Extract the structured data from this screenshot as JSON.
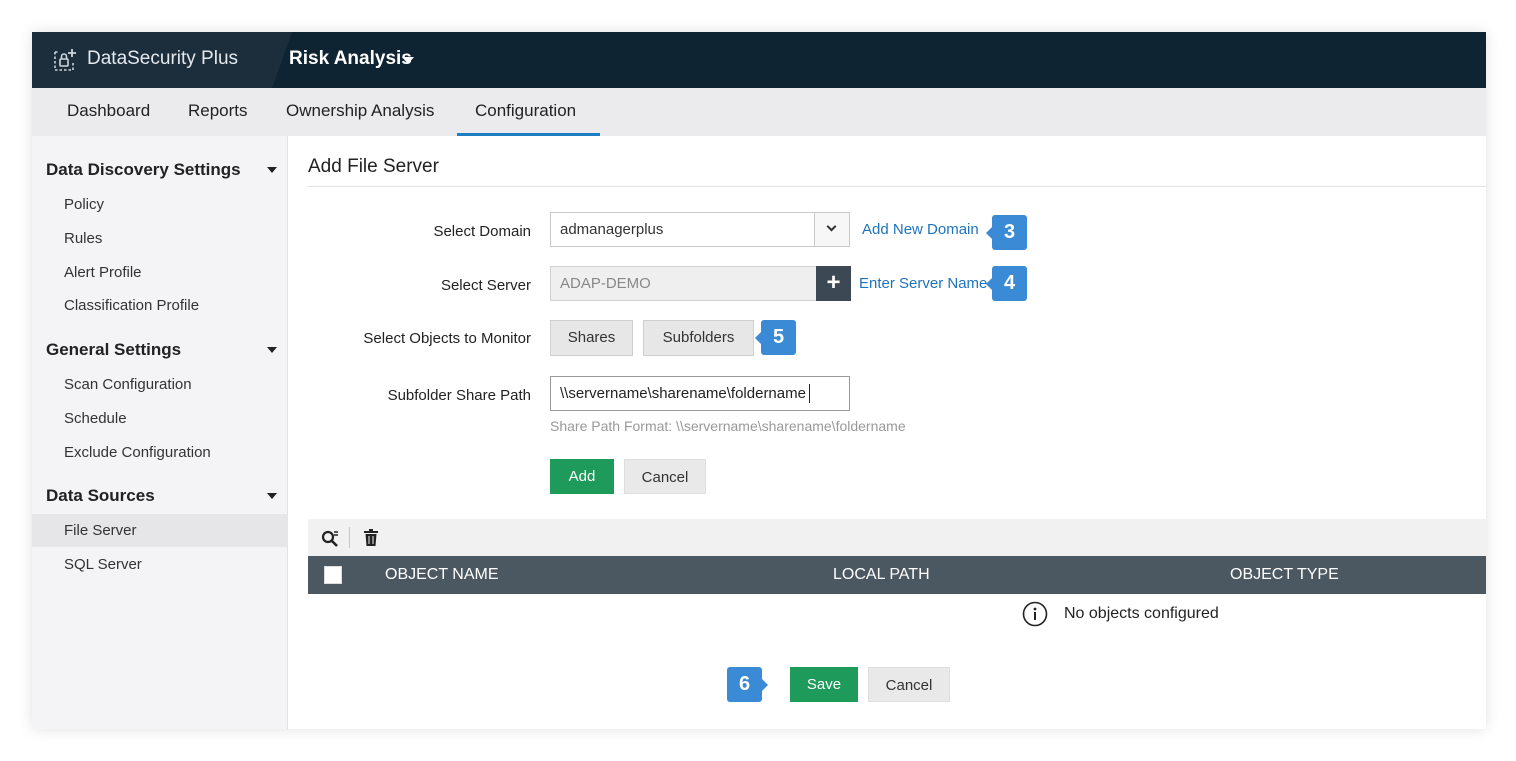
{
  "app": {
    "brand": "DataSecurity Plus",
    "module": "Risk Analysis"
  },
  "tabs": [
    {
      "label": "Dashboard"
    },
    {
      "label": "Reports"
    },
    {
      "label": "Ownership Analysis"
    },
    {
      "label": "Configuration",
      "active": true
    }
  ],
  "sidebar": {
    "sections": [
      {
        "title": "Data Discovery Settings",
        "items": [
          "Policy",
          "Rules",
          "Alert Profile",
          "Classification Profile"
        ]
      },
      {
        "title": "General Settings",
        "items": [
          "Scan Configuration",
          "Schedule",
          "Exclude Configuration"
        ]
      },
      {
        "title": "Data Sources",
        "items": [
          "File Server",
          "SQL Server"
        ]
      }
    ],
    "selected_item": "File Server"
  },
  "page": {
    "title": "Add File Server"
  },
  "form": {
    "domain_label": "Select Domain",
    "domain_value": "admanagerplus",
    "add_domain_link": "Add New Domain",
    "server_label": "Select Server",
    "server_placeholder": "ADAP-DEMO",
    "add_server_icon": "+",
    "enter_server_link": "Enter Server Name",
    "objects_label": "Select Objects to Monitor",
    "shares_button": "Shares",
    "subfolders_button": "Subfolders",
    "path_label": "Subfolder Share Path",
    "path_value": "\\\\servername\\sharename\\foldername",
    "path_hint": "Share Path Format: \\\\servername\\sharename\\foldername",
    "add_button": "Add",
    "cancel_button": "Cancel"
  },
  "callouts": {
    "c3": "3",
    "c4": "4",
    "c5": "5",
    "c6": "6"
  },
  "table": {
    "columns": [
      "OBJECT NAME",
      "LOCAL PATH",
      "OBJECT TYPE"
    ],
    "empty_message": "No objects configured"
  },
  "footer": {
    "save_button": "Save",
    "cancel_button": "Cancel"
  },
  "colors": {
    "topbar": "#0e2433",
    "accent": "#1e7ec2",
    "primary_button": "#1e9a5a",
    "callout": "#3a8ad6",
    "table_header": "#4b5862"
  }
}
